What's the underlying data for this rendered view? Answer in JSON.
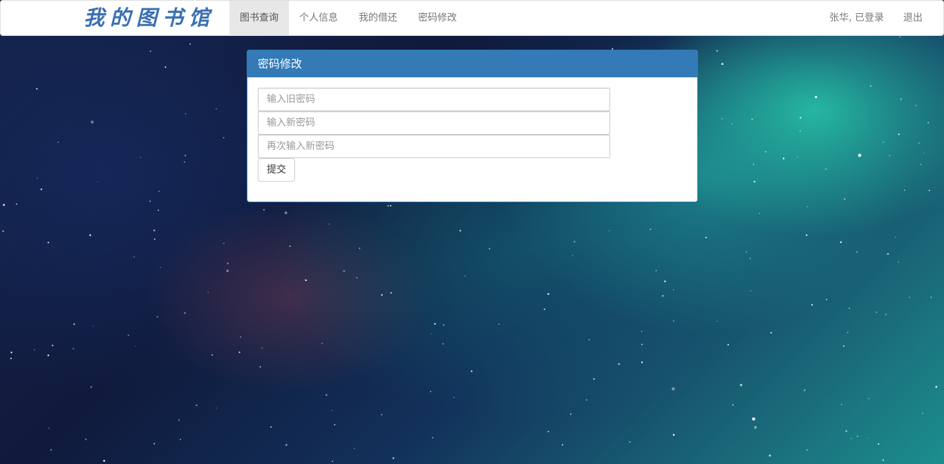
{
  "brand": {
    "title": "我的图书馆"
  },
  "nav": {
    "items": [
      {
        "label": "图书查询",
        "active": true
      },
      {
        "label": "个人信息",
        "active": false
      },
      {
        "label": "我的借还",
        "active": false
      },
      {
        "label": "密码修改",
        "active": false
      }
    ],
    "user_status": "张华, 已登录",
    "logout": "退出"
  },
  "panel": {
    "title": "密码修改",
    "old_password_placeholder": "输入旧密码",
    "new_password_placeholder": "输入新密码",
    "confirm_password_placeholder": "再次输入新密码",
    "submit_label": "提交"
  },
  "colors": {
    "brand": "#3a6fb3",
    "panel_header": "#337ab7",
    "active_nav_bg": "#e7e7e7"
  }
}
